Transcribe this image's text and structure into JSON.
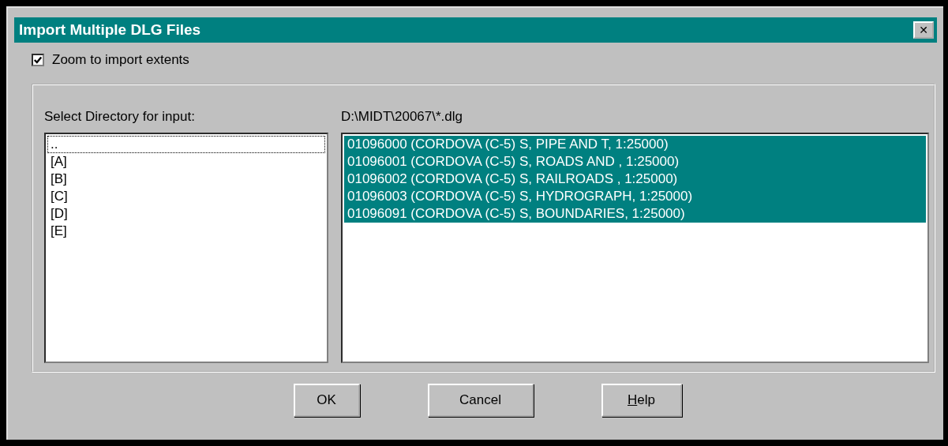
{
  "window": {
    "title": "Import Multiple DLG Files",
    "close": "✕"
  },
  "zoom_checkbox": {
    "label": "Zoom to import extents",
    "checked": true
  },
  "directory": {
    "label": "Select Directory for input:",
    "items": [
      {
        "label": "..",
        "focused": true
      },
      {
        "label": "[A]",
        "focused": false
      },
      {
        "label": "[B]",
        "focused": false
      },
      {
        "label": "[C]",
        "focused": false
      },
      {
        "label": "[D]",
        "focused": false
      },
      {
        "label": "[E]",
        "focused": false
      }
    ]
  },
  "files": {
    "path": "D:\\MIDT\\20067\\*.dlg",
    "items": [
      {
        "label": "01096000 (CORDOVA (C-5) S, PIPE AND T, 1:25000)",
        "selected": true
      },
      {
        "label": "01096001 (CORDOVA (C-5) S, ROADS AND , 1:25000)",
        "selected": true
      },
      {
        "label": "01096002 (CORDOVA (C-5) S, RAILROADS , 1:25000)",
        "selected": true
      },
      {
        "label": "01096003 (CORDOVA (C-5) S, HYDROGRAPH, 1:25000)",
        "selected": true
      },
      {
        "label": "01096091 (CORDOVA (C-5) S, BOUNDARIES, 1:25000)",
        "selected": true
      }
    ]
  },
  "buttons": [
    {
      "label": "OK"
    },
    {
      "label": "Cancel"
    },
    {
      "label": "Help",
      "first_letter_underlined": true
    }
  ]
}
